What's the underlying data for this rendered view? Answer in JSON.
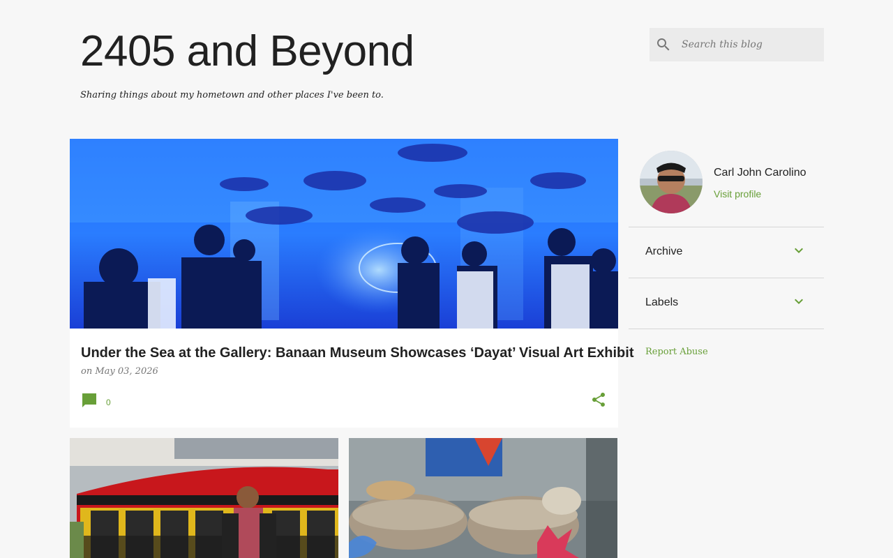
{
  "header": {
    "title": "2405 and Beyond",
    "description": "Sharing things about my hometown and other places I've been to."
  },
  "search": {
    "placeholder": "Search this blog",
    "icon": "search-icon"
  },
  "featured_post": {
    "title": "Under the Sea at the Gallery: Banaan Museum Showcases ‘Dayat’ Visual Art Exhibit",
    "date": "on May 03, 2026",
    "comment_count": "0",
    "comment_icon": "comment-icon",
    "share_icon": "share-icon"
  },
  "sidebar": {
    "profile": {
      "name": "Carl John Carolino",
      "visit_label": "Visit profile"
    },
    "widgets": [
      {
        "label": "Archive",
        "icon": "chevron-down-icon"
      },
      {
        "label": "Labels",
        "icon": "chevron-down-icon"
      }
    ],
    "report_abuse": "Report Abuse"
  },
  "colors": {
    "accent": "#689f38",
    "background": "#f7f7f7",
    "text": "#212121",
    "muted": "#757575"
  }
}
